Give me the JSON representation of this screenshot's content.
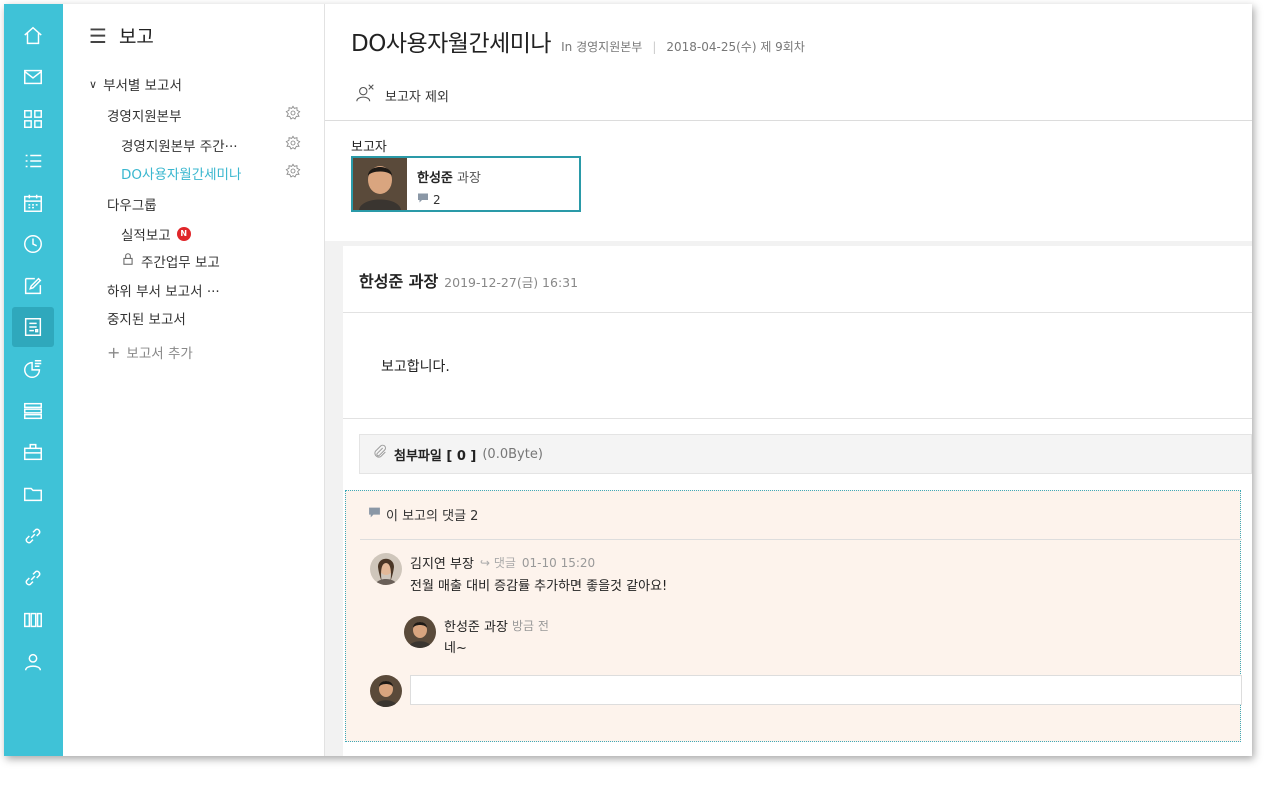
{
  "rail": {
    "items": [
      "home-icon",
      "mail-icon",
      "dashboard-icon",
      "list-icon",
      "calendar-icon",
      "clock-icon",
      "edit-icon",
      "report-icon",
      "chart-icon",
      "stack-icon",
      "briefcase-icon",
      "folder-icon",
      "link-icon",
      "link-icon",
      "apps-icon",
      "user-icon"
    ],
    "active": "report-icon"
  },
  "sidebar": {
    "title": "보고",
    "section": "부서별 보고서",
    "items": [
      {
        "label": "경영지원본부"
      },
      {
        "label": "경영지원본부 주간···"
      },
      {
        "label": "DO사용자월간세미나"
      },
      {
        "label": "다우그룹"
      },
      {
        "label": "실적보고",
        "badge": "N"
      },
      {
        "label": "주간업무 보고"
      },
      {
        "label": "하위 부서 보고서 ···"
      },
      {
        "label": "중지된 보고서"
      }
    ],
    "add_label": "보고서 추가"
  },
  "main": {
    "title": "DO사용자월간세미나",
    "in_label": "In 경영지원본부",
    "session": "2018-04-25(수) 제 9회차",
    "toolbar_exclude": "보고자 제외",
    "reporter_label": "보고자",
    "reporter": {
      "name": "한성준",
      "rank": "과장",
      "comment_count": "2"
    },
    "post": {
      "author": "한성준 과장",
      "date": "2019-12-27(금) 16:31",
      "body": "보고합니다.",
      "attach_label": "첨부파일 [ 0 ]",
      "attach_size": "(0.0Byte)"
    },
    "comments": {
      "header": "이 보고의 댓글 2",
      "c1": {
        "name": "김지연 부장",
        "reply": "댓글",
        "time": "01-10 15:20",
        "text": "전월 매출 대비 증감률 추가하면 좋을것 같아요!"
      },
      "c2": {
        "name": "한성준 과장",
        "ago": "방금 전",
        "text": "네~"
      }
    }
  },
  "colors": {
    "rail": "#3fc2d7",
    "accent": "#3ab7cf",
    "comment_bg": "#fdf3ec",
    "badge": "#e0262a"
  }
}
